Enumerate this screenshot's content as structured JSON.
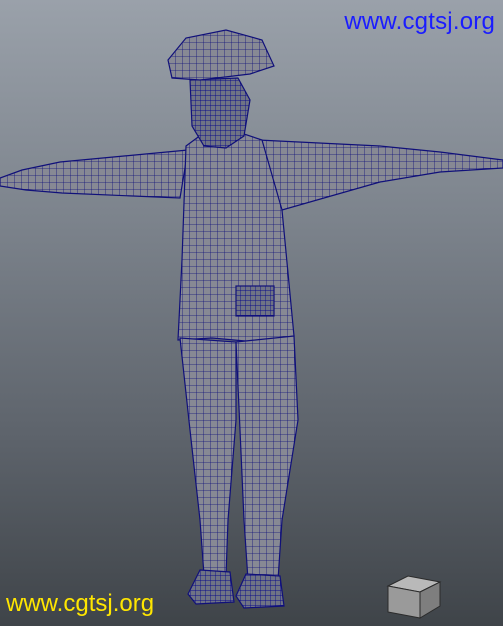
{
  "watermarks": {
    "top": "www.cgtsj.org",
    "bottom": "www.cgtsj.org"
  },
  "colors": {
    "wire": "#10107a",
    "mesh_fill": "#878994",
    "watermark_top": "#1a1cff",
    "watermark_bottom": "#ffe600"
  },
  "scene": {
    "subject": "character-wireframe-model",
    "objects": [
      "character-mesh",
      "ground-cube"
    ]
  }
}
